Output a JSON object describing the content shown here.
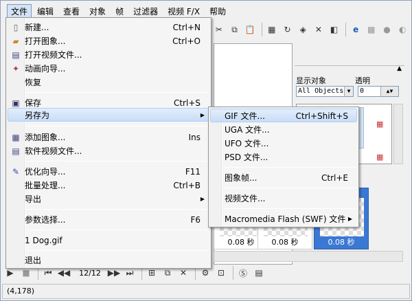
{
  "menubar": {
    "items": [
      "文件",
      "编辑",
      "查看",
      "对象",
      "帧",
      "过滤器",
      "视频 F/X",
      "帮助"
    ]
  },
  "toolbar1": {
    "icons": [
      "cut-icon",
      "copy-icon",
      "paste-icon",
      "crop-icon",
      "rotate-icon",
      "recolor-icon",
      "scissors-icon",
      "layer-icon",
      "ie-icon",
      "filter-icon",
      "disabled-icon",
      "wizard-icon"
    ]
  },
  "panel": {
    "display_label": "显示对象",
    "transparency_label": "透明",
    "display_value": "All Objects",
    "transparency_value": "0"
  },
  "thumbs": {
    "labels": [
      "0.08 秒",
      "0.08 秒",
      "0.08 秒"
    ]
  },
  "toolbar2": {
    "frame_counter": "12/12"
  },
  "status": {
    "coords": "(4,178)"
  },
  "file_menu": {
    "items": [
      {
        "label": "新建...",
        "shortcut": "Ctrl+N",
        "icon": "new-icon"
      },
      {
        "label": "打开图象...",
        "shortcut": "Ctrl+O",
        "icon": "open-image-icon"
      },
      {
        "label": "打开视频文件...",
        "shortcut": "",
        "icon": "open-video-icon"
      },
      {
        "label": "动画向导...",
        "shortcut": "",
        "icon": "wizard-icon"
      },
      {
        "label": "恢复",
        "shortcut": "",
        "icon": ""
      },
      {
        "label": "保存",
        "shortcut": "Ctrl+S",
        "icon": "save-icon"
      },
      {
        "label": "另存为",
        "shortcut": "",
        "icon": "",
        "submenu": true
      },
      {
        "label": "添加图象...",
        "shortcut": "Ins",
        "icon": "add-image-icon"
      },
      {
        "label": "软件视频文件...",
        "shortcut": "",
        "icon": "video-file-icon"
      },
      {
        "label": "优化向导...",
        "shortcut": "F11",
        "icon": "optimize-icon"
      },
      {
        "label": "批量处理...",
        "shortcut": "Ctrl+B",
        "icon": ""
      },
      {
        "label": "导出",
        "shortcut": "",
        "icon": "",
        "submenu": true
      },
      {
        "label": "参数选择...",
        "shortcut": "F6",
        "icon": ""
      },
      {
        "label": "1 Dog.gif",
        "shortcut": "",
        "icon": ""
      },
      {
        "label": "退出",
        "shortcut": "",
        "icon": ""
      }
    ]
  },
  "saveas_menu": {
    "items": [
      {
        "label": "GIF 文件...",
        "shortcut": "Ctrl+Shift+S"
      },
      {
        "label": "UGA 文件...",
        "shortcut": ""
      },
      {
        "label": "UFO 文件...",
        "shortcut": ""
      },
      {
        "label": "PSD 文件...",
        "shortcut": ""
      },
      {
        "label": "图象帧...",
        "shortcut": "Ctrl+E"
      },
      {
        "label": "视频文件...",
        "shortcut": ""
      },
      {
        "label": "Macromedia Flash (SWF) 文件",
        "shortcut": "",
        "submenu": true
      }
    ]
  }
}
